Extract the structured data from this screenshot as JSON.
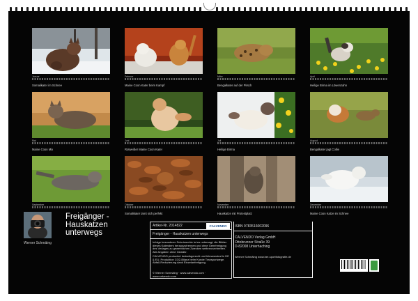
{
  "calendar": {
    "title_lines": [
      "Freigänger -",
      "Hauskatzen",
      "unterwegs"
    ],
    "author": "Werner Schmäing",
    "months": [
      {
        "caption": "Somalikater im Schnee",
        "label": "Januar"
      },
      {
        "caption": "Maine Coon Kater beim Kampf",
        "label": "Februar"
      },
      {
        "caption": "Bengalkater auf der Pirsch",
        "label": "März"
      },
      {
        "caption": "Heilige Birma im Löwenzahn",
        "label": "April"
      },
      {
        "caption": "Maine Coon Mix",
        "label": "Mai"
      },
      {
        "caption": "Rotweißer Maine Coon Kater",
        "label": "Juni"
      },
      {
        "caption": "Heilige Birma",
        "label": "Juli"
      },
      {
        "caption": "Bengalkater jagt Collie",
        "label": "August"
      },
      {
        "caption": "Maine Coon",
        "label": "September"
      },
      {
        "caption": "Somalikater tarnt sich perfekt",
        "label": "Oktober"
      },
      {
        "caption": "Hauskatze mit Protestplatz",
        "label": "November"
      },
      {
        "caption": "Maine Coon Katze im Schnee",
        "label": "Dezember"
      }
    ]
  },
  "info": {
    "artikel_nr": "Artikel-Nr. 2014822",
    "product_title": "Freigänger - Hauskatzen unterwegs",
    "text_1": "Infolge besonderer Schutzrechte ist es untersagt, die Blätter dieses Kalenders herauszutrennen und ohne Genehmigung des Verlages zu gewerblichen Zwecken weiterzuverbreiten. Alle Angaben ohne Gewähr.",
    "text_2": "CALVENDO produziert bedarfsgerecht und klimaneutral in DE & EU. Produktion CO2-Bilanz beim Kunde Transportwege. Abfall-Reduzierung dank Einzelanfertigung.",
    "footer_link": "© Werner Schmäing · www.calvendo.com · www.calvendo.com",
    "logo_text": "CALVENDO",
    "isbn": "ISBN 9783516002096",
    "publisher_lines": [
      "CALVENDO Verlag GmbH",
      "Ottobrunner Straße 39",
      "D-82008 Unterhaching"
    ],
    "photographer_link": "Werner Schmäing www.ber-sportfotografie.de"
  }
}
